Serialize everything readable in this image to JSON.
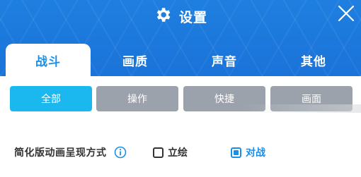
{
  "header": {
    "title": "设置",
    "icons": {
      "settings": "gear-icon",
      "close": "close-icon"
    }
  },
  "tabs": [
    {
      "label": "战斗",
      "active": true
    },
    {
      "label": "画质",
      "active": false
    },
    {
      "label": "声音",
      "active": false
    },
    {
      "label": "其他",
      "active": false
    }
  ],
  "subtabs": [
    {
      "label": "全部",
      "active": true
    },
    {
      "label": "操作",
      "active": false
    },
    {
      "label": "快捷",
      "active": false
    },
    {
      "label": "画面",
      "active": false
    }
  ],
  "settings": [
    {
      "label": "简化版动画呈现方式",
      "info_icon": "info-icon",
      "options": [
        {
          "label": "立绘",
          "checked": false
        },
        {
          "label": "对战",
          "checked": true
        }
      ]
    }
  ],
  "colors": {
    "header_blue": "#1a73d9",
    "accent_blue": "#1a8fe8",
    "subtab_active": "#1bb7ef",
    "subtab_inactive": "#9ba2ab"
  }
}
